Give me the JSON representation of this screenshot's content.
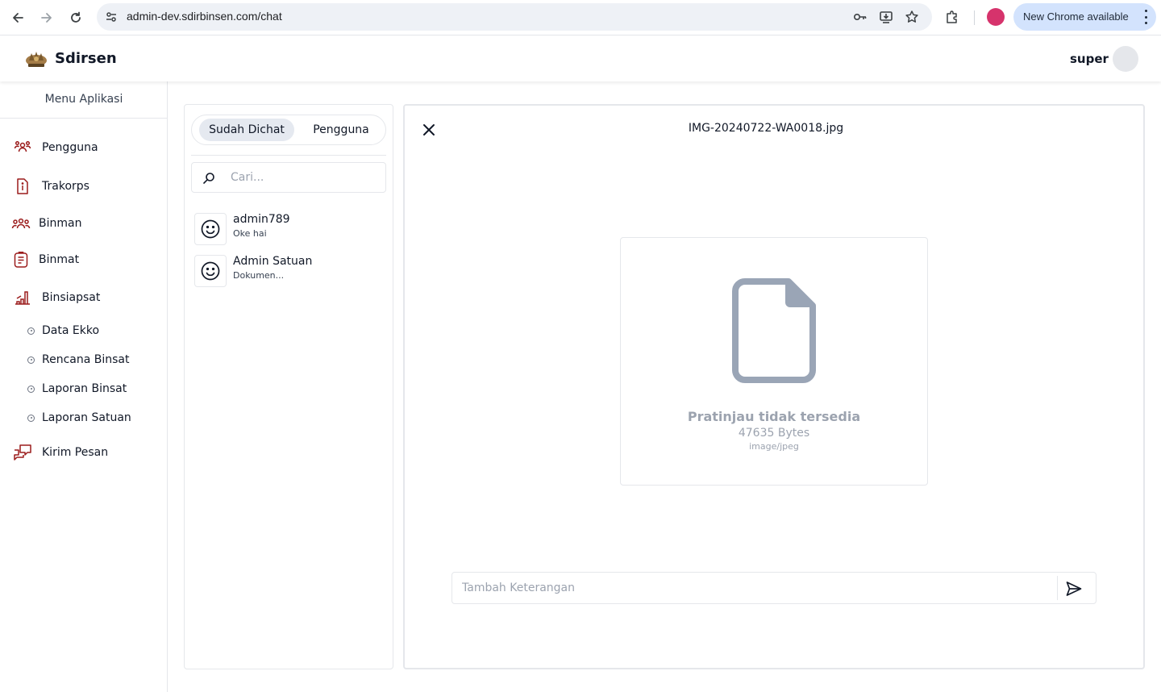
{
  "browser": {
    "url": "admin-dev.sdirbinsen.com/chat",
    "update_label": "New Chrome available"
  },
  "header": {
    "brand": "Sdirsen",
    "username": "super"
  },
  "sidebar": {
    "title": "Menu Aplikasi",
    "items": [
      {
        "label": "Pengguna",
        "icon": "users-icon"
      },
      {
        "label": "Trakorps",
        "icon": "document-info-icon"
      },
      {
        "label": "Binman",
        "icon": "group-icon"
      },
      {
        "label": "Binmat",
        "icon": "clipboard-icon"
      },
      {
        "label": "Binsiapsat",
        "icon": "chart-icon"
      }
    ],
    "sub_items": [
      {
        "label": "Data Ekko"
      },
      {
        "label": "Rencana Binsat"
      },
      {
        "label": "Laporan Binsat"
      },
      {
        "label": "Laporan Satuan"
      }
    ],
    "last_item": {
      "label": "Kirim Pesan",
      "icon": "chat-bubbles-icon"
    }
  },
  "chat_list": {
    "tabs": [
      {
        "label": "Sudah Dichat",
        "active": true
      },
      {
        "label": "Pengguna",
        "active": false
      }
    ],
    "search_placeholder": "Cari...",
    "conversations": [
      {
        "name": "admin789",
        "last_message": "Oke hai"
      },
      {
        "name": "Admin Satuan",
        "last_message": "Dokumen..."
      }
    ]
  },
  "preview": {
    "file_name": "IMG-20240722-WA0018.jpg",
    "unavailable_text": "Pratinjau tidak tersedia",
    "size_text": "47635 Bytes",
    "mime_type": "image/jpeg",
    "caption_placeholder": "Tambah Keterangan"
  },
  "colors": {
    "brand_red": "#9b1c1c",
    "muted_gray": "#9ca3af",
    "active_tab": "#e5e9f0"
  }
}
